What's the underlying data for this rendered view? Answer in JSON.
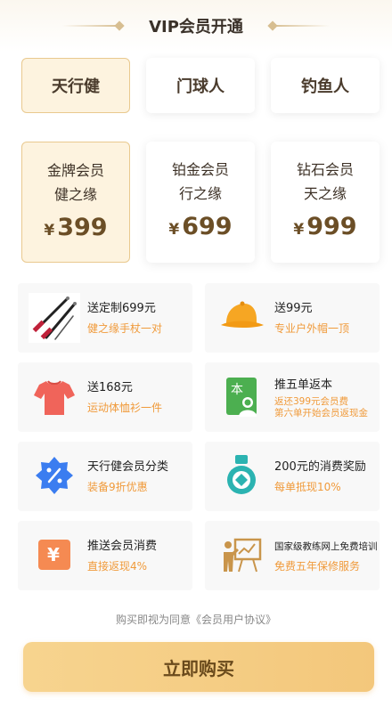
{
  "header": {
    "title": "VIP会员开通"
  },
  "tabs": [
    {
      "label": "天行健",
      "active": true
    },
    {
      "label": "门球人",
      "active": false
    },
    {
      "label": "钓鱼人",
      "active": false
    }
  ],
  "plans": [
    {
      "line1": "金牌会员",
      "line2": "健之缘",
      "currency": "¥",
      "price": "399",
      "active": true
    },
    {
      "line1": "铂金会员",
      "line2": "行之缘",
      "currency": "¥",
      "price": "699",
      "active": false
    },
    {
      "line1": "钻石会员",
      "line2": "天之缘",
      "currency": "¥",
      "price": "999",
      "active": false
    }
  ],
  "benefits": [
    {
      "icon": "hiking-poles-icon",
      "title": "送定制699元",
      "sub": "健之缘手杖一对"
    },
    {
      "icon": "cap-icon",
      "title": "送99元",
      "sub": "专业户外帽一顶"
    },
    {
      "icon": "tshirt-icon",
      "title": "送168元",
      "sub": "运动体恤衫一件"
    },
    {
      "icon": "referral-book-icon",
      "title": "推五单返本",
      "sub": "返还399元会员费",
      "sub2": "第六单开始会员返现金"
    },
    {
      "icon": "discount-badge-icon",
      "title": "天行健会员分类",
      "sub": "装备9折优惠"
    },
    {
      "icon": "medal-icon",
      "title": "200元的消费奖励",
      "sub": "每单抵现10%"
    },
    {
      "icon": "yen-cashback-icon",
      "title": "推送会员消费",
      "sub": "直接返现4%"
    },
    {
      "icon": "trainer-board-icon",
      "title": "国家级教练网上免费培训",
      "sub": "免费五年保修服务"
    }
  ],
  "agreement": {
    "text": "购买即视为同意",
    "link": "《会员用户协议》"
  },
  "buy_button": {
    "label": "立即购买"
  },
  "colors": {
    "accent": "#f09a3a",
    "active_bg": "#fdf3df",
    "active_border": "#e9c98f",
    "button": "#f5cd84",
    "price": "#6b4e26"
  }
}
